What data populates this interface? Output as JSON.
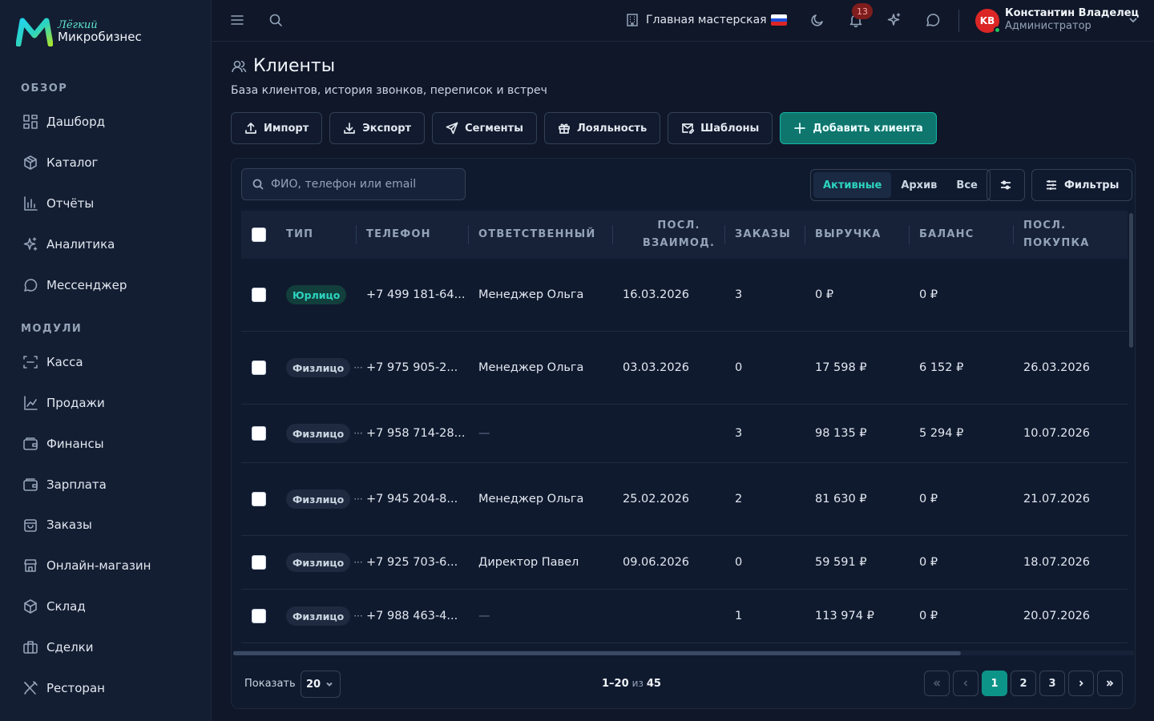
{
  "brand": {
    "sub": "Лёгкий",
    "main": "Микробизнес"
  },
  "sidebar": {
    "section_overview": "ОБЗОР",
    "section_modules": "МОДУЛИ",
    "overview": [
      {
        "label": "Дашборд",
        "icon": "grid-icon"
      },
      {
        "label": "Каталог",
        "icon": "package-icon"
      },
      {
        "label": "Отчёты",
        "icon": "bar-chart-icon"
      },
      {
        "label": "Аналитика",
        "icon": "sparkles-icon"
      },
      {
        "label": "Мессенджер",
        "icon": "message-icon"
      }
    ],
    "modules": [
      {
        "label": "Касса",
        "icon": "scan-icon"
      },
      {
        "label": "Продажи",
        "icon": "line-chart-icon"
      },
      {
        "label": "Финансы",
        "icon": "wallet-icon"
      },
      {
        "label": "Зарплата",
        "icon": "wallet-icon"
      },
      {
        "label": "Заказы",
        "icon": "bag-icon"
      },
      {
        "label": "Онлайн-магазин",
        "icon": "store-icon"
      },
      {
        "label": "Склад",
        "icon": "box-icon"
      },
      {
        "label": "Сделки",
        "icon": "briefcase-icon"
      },
      {
        "label": "Ресторан",
        "icon": "utensils-icon"
      }
    ]
  },
  "topbar": {
    "workshop": "Главная мастерская",
    "notifications": "13",
    "user_initials": "KB",
    "user_name": "Константин Владелец",
    "user_role": "Администратор"
  },
  "page": {
    "title": "Клиенты",
    "subtitle": "База клиентов, история звонков, переписок и встреч"
  },
  "actions": {
    "import": "Импорт",
    "export": "Экспорт",
    "segments": "Сегменты",
    "loyalty": "Лояльность",
    "templates": "Шаблоны",
    "add": "Добавить клиента"
  },
  "toolbar": {
    "search_placeholder": "ФИО, телефон или email",
    "tabs": [
      "Активные",
      "Архив",
      "Все"
    ],
    "filters": "Фильтры"
  },
  "table": {
    "headers": {
      "type": "ТИП",
      "phone": "ТЕЛЕФОН",
      "manager": "ОТВЕТСТВЕННЫЙ",
      "last_contact_1": "ПОСЛ.",
      "last_contact_2": "ВЗАИМОД.",
      "orders": "ЗАКАЗЫ",
      "revenue": "ВЫРУЧКА",
      "balance": "БАЛАНС",
      "last_purchase_1": "ПОСЛ.",
      "last_purchase_2": "ПОКУПКА"
    },
    "rows": [
      {
        "type": "Юрлицо",
        "legal": true,
        "phone": "+7 499 181-64...",
        "manager": "Менеджер Ольга",
        "last_contact": "16.03.2026",
        "orders": "3",
        "revenue": "0 ₽",
        "balance": "0 ₽",
        "last_purchase": ""
      },
      {
        "type": "Физлицо",
        "legal": false,
        "phone": "+7 975 905-2...",
        "manager": "Менеджер Ольга",
        "last_contact": "03.03.2026",
        "orders": "0",
        "revenue": "17 598 ₽",
        "balance": "6 152 ₽",
        "last_purchase": "26.03.2026"
      },
      {
        "type": "Физлицо",
        "legal": false,
        "phone": "+7 958 714-28...",
        "manager": "—",
        "last_contact": "",
        "orders": "3",
        "revenue": "98 135 ₽",
        "balance": "5 294 ₽",
        "last_purchase": "10.07.2026"
      },
      {
        "type": "Физлицо",
        "legal": false,
        "phone": "+7 945 204-8...",
        "manager": "Менеджер Ольга",
        "last_contact": "25.02.2026",
        "orders": "2",
        "revenue": "81 630 ₽",
        "balance": "0 ₽",
        "last_purchase": "21.07.2026"
      },
      {
        "type": "Физлицо",
        "legal": false,
        "phone": "+7 925 703-6...",
        "manager": "Директор Павел",
        "last_contact": "09.06.2026",
        "orders": "0",
        "revenue": "59 591 ₽",
        "balance": "0 ₽",
        "last_purchase": "18.07.2026"
      },
      {
        "type": "Физлицо",
        "legal": false,
        "phone": "+7 988 463-4...",
        "manager": "—",
        "last_contact": "",
        "orders": "1",
        "revenue": "113 974 ₽",
        "balance": "0 ₽",
        "last_purchase": "20.07.2026"
      }
    ],
    "ellipsis": "···"
  },
  "footer": {
    "show_label": "Показать",
    "per_page": "20",
    "range": "1–20",
    "of": "из",
    "total": "45",
    "pages": [
      "1",
      "2",
      "3"
    ]
  },
  "colors": {
    "accent": "#0d9488",
    "accent_text": "#2dd4bf",
    "background": "#0f1729",
    "sidebar": "#141e33"
  }
}
